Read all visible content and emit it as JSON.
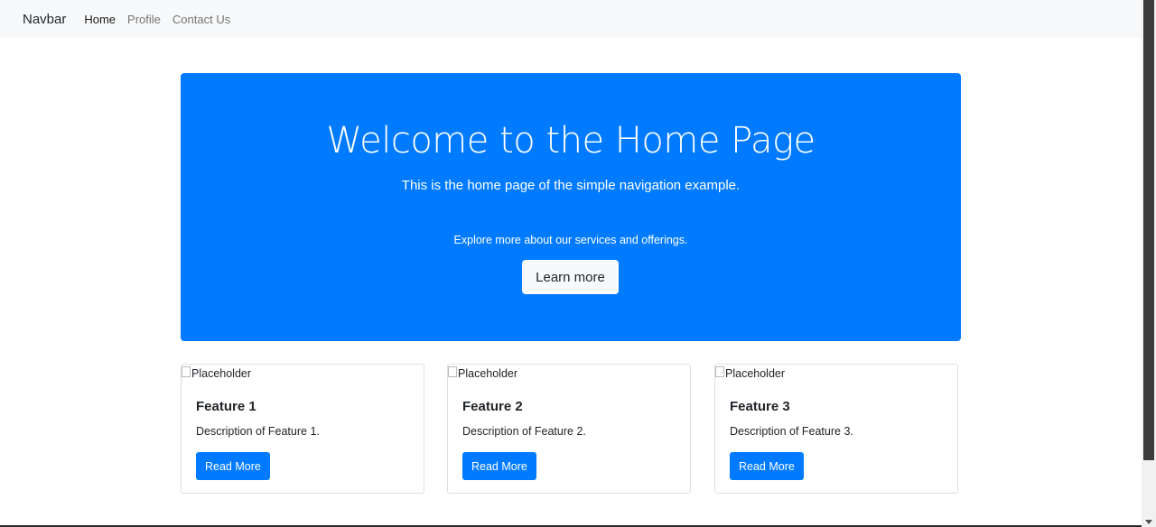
{
  "navbar": {
    "brand": "Navbar",
    "links": [
      {
        "label": "Home",
        "active": true
      },
      {
        "label": "Profile",
        "active": false
      },
      {
        "label": "Contact Us",
        "active": false
      }
    ]
  },
  "hero": {
    "title": "Welcome to the Home Page",
    "lead": "This is the home page of the simple navigation example.",
    "text": "Explore more about our services and offerings.",
    "button_label": "Learn more",
    "background_color": "#007bff"
  },
  "cards": [
    {
      "image_alt": "Placeholder",
      "title": "Feature 1",
      "text": "Description of Feature 1.",
      "button_label": "Read More"
    },
    {
      "image_alt": "Placeholder",
      "title": "Feature 2",
      "text": "Description of Feature 2.",
      "button_label": "Read More"
    },
    {
      "image_alt": "Placeholder",
      "title": "Feature 3",
      "text": "Description of Feature 3.",
      "button_label": "Read More"
    }
  ],
  "colors": {
    "primary": "#007bff",
    "navbar_bg": "#f8f9fa"
  }
}
